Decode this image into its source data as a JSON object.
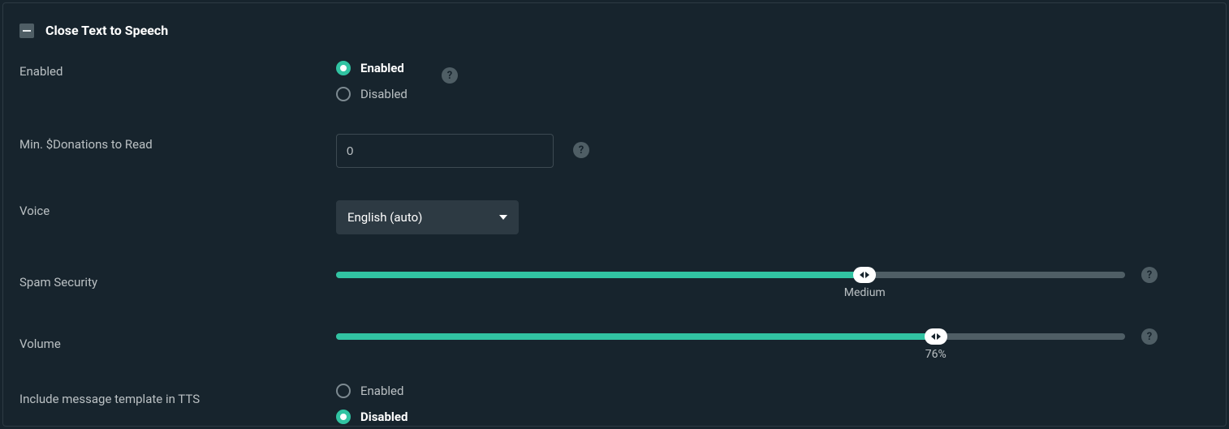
{
  "panel": {
    "title": "Close Text to Speech"
  },
  "enabled": {
    "label": "Enabled",
    "option_enabled": "Enabled",
    "option_disabled": "Disabled",
    "selected": "enabled"
  },
  "min_donation": {
    "label": "Min. $Donations to Read",
    "value": "0"
  },
  "voice": {
    "label": "Voice",
    "selected": "English (auto)"
  },
  "spam": {
    "label": "Spam Security",
    "value_text": "Medium",
    "percent": 67
  },
  "volume": {
    "label": "Volume",
    "value_text": "76%",
    "percent": 76
  },
  "include_template": {
    "label": "Include message template in TTS",
    "option_enabled": "Enabled",
    "option_disabled": "Disabled",
    "selected": "disabled"
  },
  "help_glyph": "?"
}
